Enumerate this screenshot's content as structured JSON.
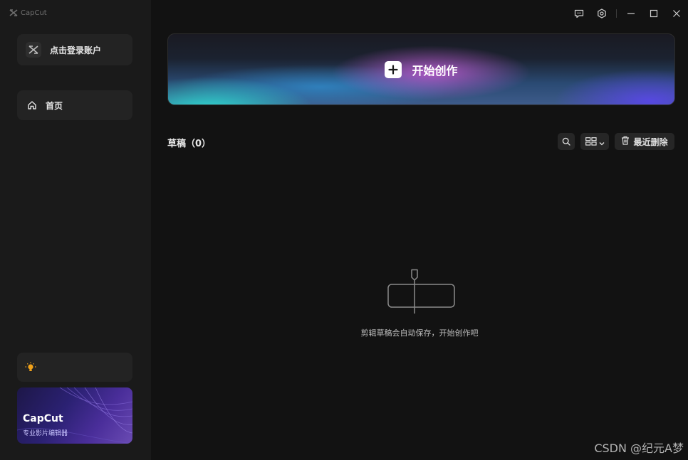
{
  "app": {
    "title": "CapCut",
    "icon": "capcut-logo-icon"
  },
  "window_controls": {
    "items": [
      {
        "name": "feedback-icon"
      },
      {
        "name": "settings-icon"
      },
      {
        "name": "minimize-icon"
      },
      {
        "name": "maximize-icon"
      },
      {
        "name": "close-icon"
      }
    ]
  },
  "sidebar": {
    "login_label": "点击登录账户",
    "nav": [
      {
        "label": "首页",
        "icon": "home-icon"
      }
    ],
    "tip_icon": "lightbulb-icon",
    "promo": {
      "title": "CapCut",
      "subtitle": "专业影片编辑器"
    }
  },
  "main": {
    "create_label": "开始创作",
    "drafts_title": "草稿（0）",
    "toolbar": {
      "search_icon": "search-icon",
      "view_icon": "grid-view-icon",
      "recent_delete_label": "最近删除"
    },
    "empty_message": "剪辑草稿会自动保存，开始创作吧"
  },
  "watermark": "CSDN @纪元A梦",
  "colors": {
    "background": "#121212",
    "sidebar": "#1a1a1a",
    "card": "#232323",
    "accent_cyan": "#2ce1d6",
    "accent_purple": "#5748e1"
  }
}
